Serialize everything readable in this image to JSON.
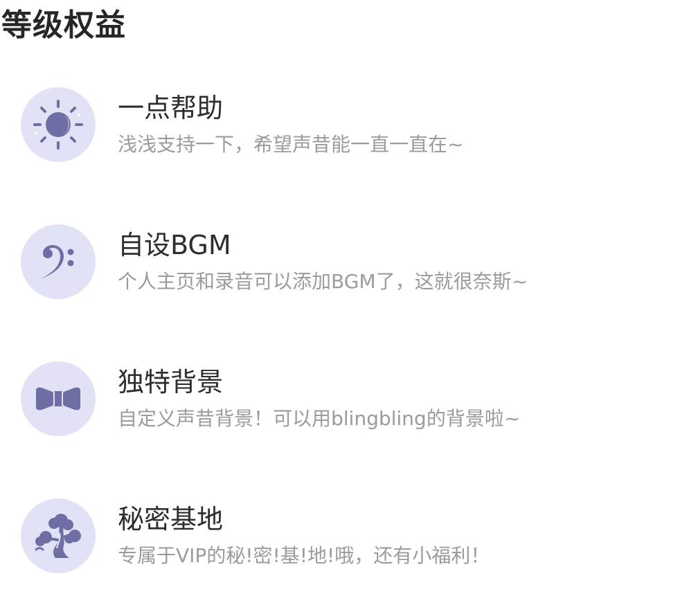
{
  "page": {
    "title": "等级权益"
  },
  "benefits": [
    {
      "icon": "sun-icon",
      "title": "一点帮助",
      "desc": "浅浅支持一下，希望声昔能一直一直在~"
    },
    {
      "icon": "bass-clef-icon",
      "title": "自设BGM",
      "desc": "个人主页和录音可以添加BGM了，这就很奈斯~"
    },
    {
      "icon": "bow-tie-icon",
      "title": "独特背景",
      "desc": "自定义声昔背景！可以用blingbling的背景啦~"
    },
    {
      "icon": "bonsai-tree-icon",
      "title": "秘密基地",
      "desc": "专属于VIP的秘!密!基!地!哦，还有小福利！"
    }
  ],
  "colors": {
    "icon_bg": "#e2e2f6",
    "icon_fg": "#6e6ea4",
    "title": "#2d2d2d",
    "desc": "#9b9b9b"
  }
}
